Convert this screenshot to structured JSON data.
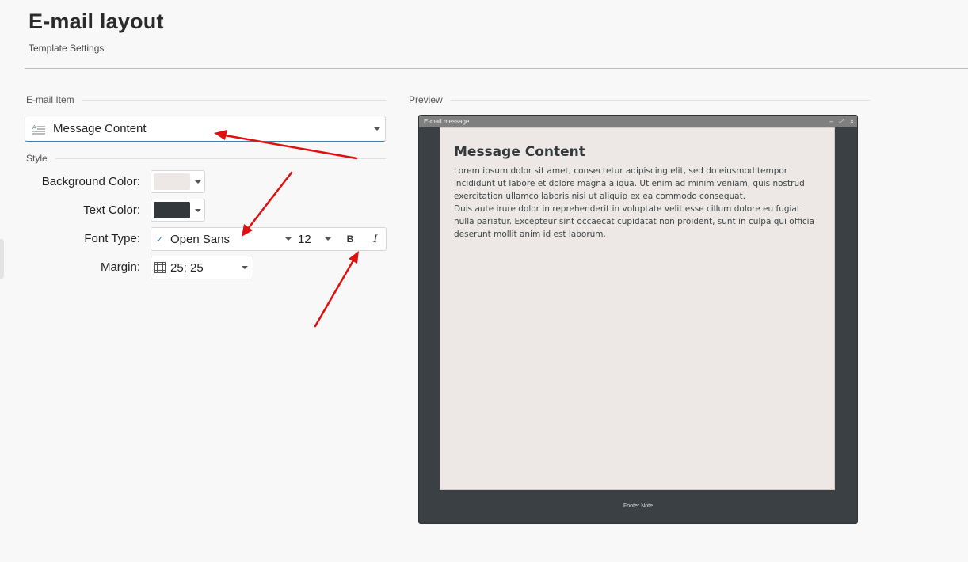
{
  "header": {
    "title": "E-mail layout",
    "subtitle": "Template Settings"
  },
  "email_item": {
    "section_label": "E-mail Item",
    "selected": "Message Content"
  },
  "style": {
    "section_label": "Style",
    "background_color": {
      "label": "Background Color:",
      "value": "#ede8e5"
    },
    "text_color": {
      "label": "Text Color:",
      "value": "#33393b"
    },
    "font_type": {
      "label": "Font Type:",
      "font_name": "Open Sans",
      "size": "12",
      "bold_label": "B",
      "italic_label": "I"
    },
    "margin": {
      "label": "Margin:",
      "value": "25; 25"
    }
  },
  "preview": {
    "section_label": "Preview",
    "window_title": "E-mail message",
    "controls": [
      "–",
      "⤢",
      "×"
    ],
    "message_title": "Message Content",
    "message_body_1": "Lorem ipsum dolor sit amet, consectetur adipiscing elit, sed do eiusmod tempor incididunt ut labore et dolore magna aliqua. Ut enim ad minim veniam, quis nostrud exercitation ullamco laboris nisi ut aliquip ex ea commodo consequat.",
    "message_body_2": "Duis aute irure dolor in reprehenderit in voluptate velit esse cillum dolore eu fugiat nulla pariatur. Excepteur sint occaecat cupidatat non proident, sunt in culpa qui officia deserunt mollit anim id est laborum.",
    "footer": "Footer Note",
    "window_frame_color": "#3a4043",
    "paper_color": "#ede8e5"
  },
  "colors": {
    "annotation_arrow": "#e01010",
    "accent_underline": "#3b7fa0",
    "check_accent": "#3b7fc4"
  }
}
